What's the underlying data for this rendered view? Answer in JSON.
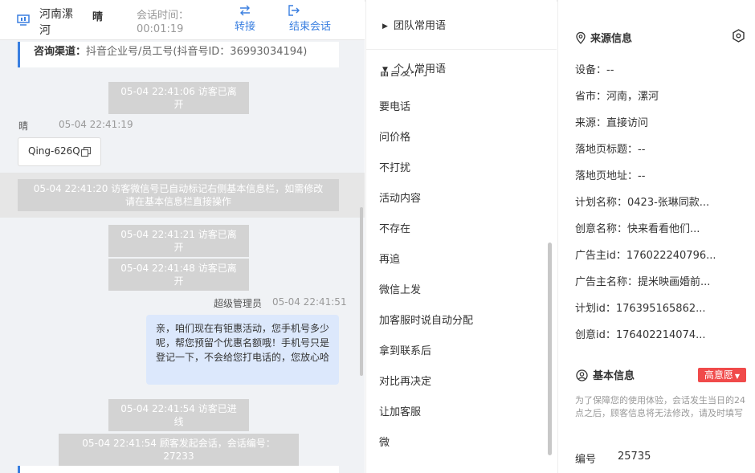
{
  "header": {
    "location": "河南漯河",
    "visitor_name": "晴",
    "time_label": "会话时间：",
    "time_value": "00:01:19",
    "transfer_label": "转接",
    "end_label": "结束会话"
  },
  "channel": {
    "label": "咨询渠道：",
    "value": "抖音企业号/员工号(抖音号ID：36993034194)"
  },
  "messages": {
    "sys1": "05-04 22:41:06 访客已离开",
    "peer_name": "晴",
    "peer_time": "05-04 22:41:19",
    "peer_text": "Qing-626Q",
    "sys2_line1": "05-04 22:41:20 访客微信号已自动标记右侧基本信息栏，如需修改",
    "sys2_line2": "请在基本信息栏直接操作",
    "sys3": "05-04 22:41:21 访客已离开",
    "sys4": "05-04 22:41:48 访客已离开",
    "agent_name": "超级管理员",
    "agent_time": "05-04 22:41:51",
    "agent_text": "亲，咱们现在有钜惠活动，您手机号多少呢，帮您预留个优惠名额哦！手机号只是登记一下，不会给您打电话的，您放心哈",
    "sys5": "05-04 22:41:54 访客已进线",
    "sys6": "05-04 22:41:54 顾客发起会话，会话编号：27233"
  },
  "phrases": {
    "team_group": "团队常用语",
    "personal_group": "个人常用语",
    "cut_item": "留言发不了",
    "items": [
      "要电话",
      "问价格",
      "不打扰",
      "活动内容",
      "不存在",
      "再追",
      "微信上发",
      "加客服时说自动分配",
      "拿到联系后",
      "对比再决定",
      "让加客服",
      "微"
    ]
  },
  "source_info": {
    "title": "来源信息",
    "rows": [
      "设备：--",
      "省市：河南，漯河",
      "来源：直接访问",
      "落地页标题：--",
      "落地页地址：--",
      "计划名称：0423-张琳同款...",
      "创意名称：快来看看他们...",
      "广告主id：176022240796...",
      "广告主名称：提米映画婚前...",
      "计划id：176395165862...",
      "创意id：176402214074..."
    ]
  },
  "basic_info": {
    "title": "基本信息",
    "intent_badge": "高意愿",
    "notice": "为了保障您的使用体验，会话发生当日的24点之后，顾客信息将无法修改，请及时填写",
    "id_label": "编号",
    "id_value": "25735"
  },
  "colors": {
    "accent": "#3a7fe0",
    "badge": "#f04a4a",
    "agent_bubble": "#dce8fc",
    "system_msg": "#d3d3d3"
  },
  "icons": [
    "monitor-icon",
    "transfer-icon",
    "exit-icon",
    "copy-icon",
    "location-pin-icon",
    "gear-icon",
    "user-circle-icon",
    "caret-right-icon",
    "caret-down-icon",
    "dropdown-caret-icon"
  ]
}
